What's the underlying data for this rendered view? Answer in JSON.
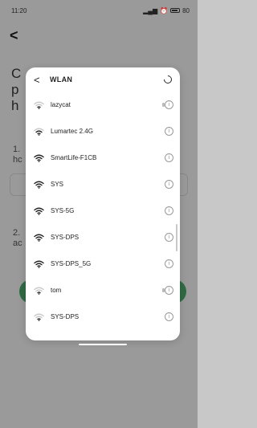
{
  "status_bar": {
    "time": "11:20",
    "battery": "80"
  },
  "background_page": {
    "back_glyph": "<",
    "title_partial": "C\np\nh",
    "step1_partial": "1.\nhc",
    "step2_partial": "2.\nac",
    "support_partial": ""
  },
  "sheet": {
    "back_glyph": "<",
    "title": "WLAN",
    "networks": [
      {
        "name": "lazycat",
        "signal": "weak",
        "locked_hint": true
      },
      {
        "name": "Lumartec 2.4G",
        "signal": "medium",
        "locked_hint": false
      },
      {
        "name": "SmartLife-F1CB",
        "signal": "full",
        "locked_hint": false
      },
      {
        "name": "SYS",
        "signal": "full",
        "locked_hint": false
      },
      {
        "name": "SYS-5G",
        "signal": "full",
        "locked_hint": false
      },
      {
        "name": "SYS-DPS",
        "signal": "full",
        "locked_hint": false
      },
      {
        "name": "SYS-DPS_5G",
        "signal": "full",
        "locked_hint": false
      },
      {
        "name": "tom",
        "signal": "weak",
        "locked_hint": true
      },
      {
        "name": "SYS-DPS",
        "signal": "weak",
        "locked_hint": false
      }
    ]
  },
  "colors": {
    "accent_green": "#2f6a44",
    "sheet_bg": "#ffffff",
    "overlay": "#9a9a9a"
  },
  "icons": {
    "refresh": "refresh-icon",
    "wifi": "wifi-icon",
    "info": "info-icon"
  }
}
